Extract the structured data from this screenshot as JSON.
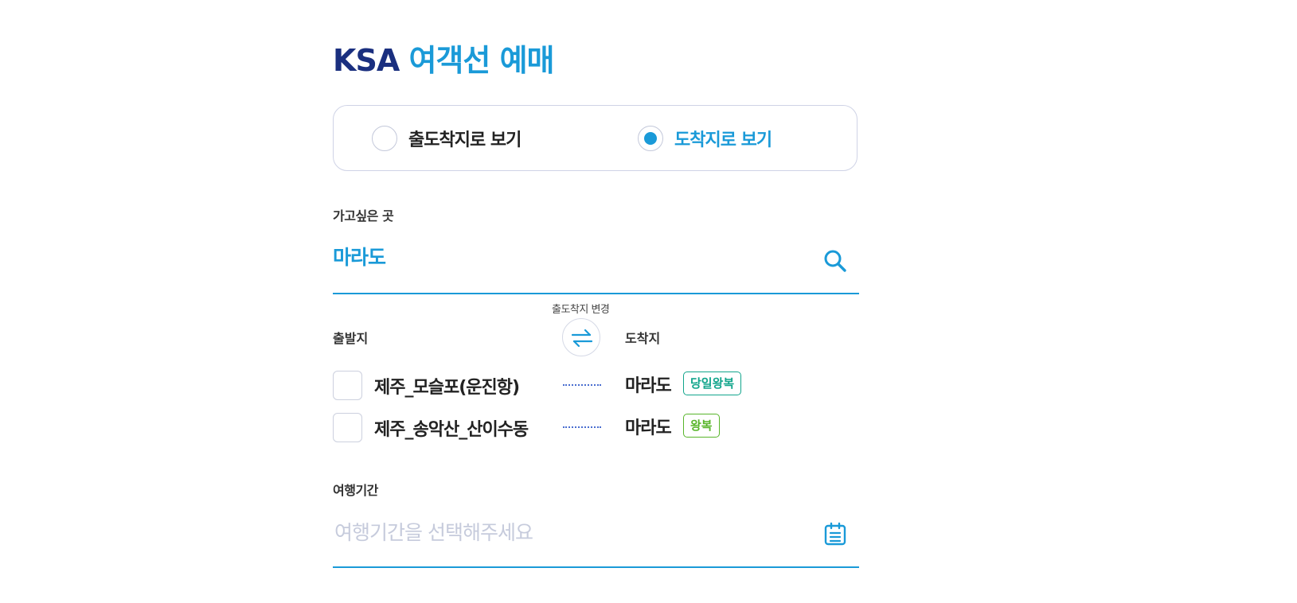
{
  "header": {
    "brand": "KSA",
    "title": "여객선 예매"
  },
  "view_toggle": {
    "options": [
      {
        "label": "출도착지로 보기",
        "checked": false
      },
      {
        "label": "도착지로 보기",
        "checked": true
      }
    ]
  },
  "destination": {
    "label": "가고싶은 곳",
    "value": "마라도",
    "search_icon": "search-icon"
  },
  "swap": {
    "caption": "출도착지 변경",
    "icon": "swap-arrows-icon"
  },
  "columns": {
    "from": "출발지",
    "to": "도착지"
  },
  "routes": [
    {
      "from": "제주_모슬포(운진항)",
      "to": "마라도",
      "badge": "당일왕복",
      "badge_color": "#12a58c"
    },
    {
      "from": "제주_송악산_산이수동",
      "to": "마라도",
      "badge": "왕복",
      "badge_color": "#58b52a"
    }
  ],
  "period": {
    "label": "여행기간",
    "placeholder": "여행기간을 선택해주세요",
    "calendar_icon": "calendar-icon"
  },
  "colors": {
    "brand_navy": "#1a2f7f",
    "accent_blue": "#1a9ad8"
  }
}
